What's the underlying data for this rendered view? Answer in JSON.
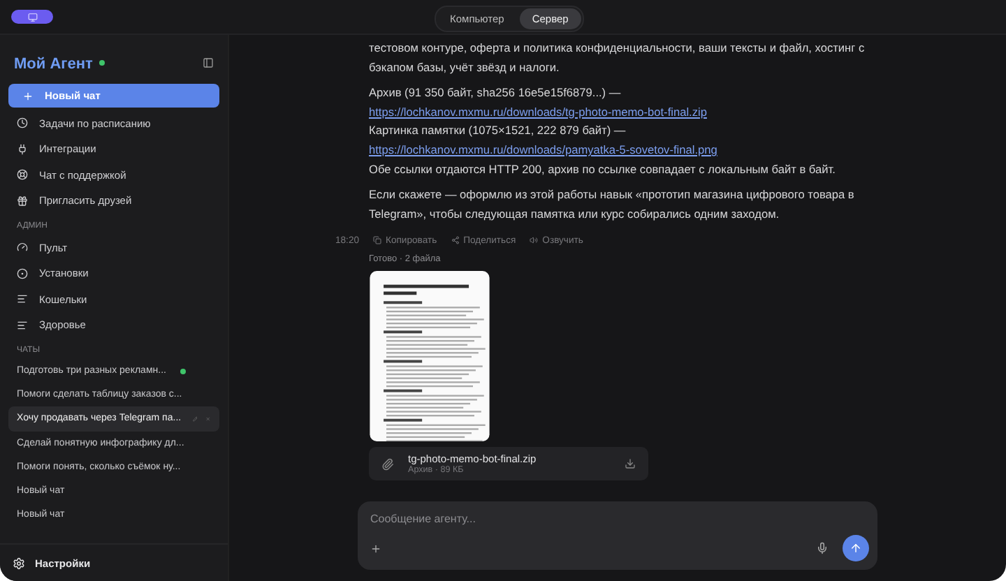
{
  "top_bar": {
    "tabs": [
      {
        "label": "Компьютер",
        "selected": false
      },
      {
        "label": "Сервер",
        "selected": true
      }
    ]
  },
  "sidebar": {
    "title": "Мой Агент",
    "online": true,
    "new_chat": "Новый чат",
    "nav": [
      "Задачи по расписанию",
      "Интеграции",
      "Чат с поддержкой",
      "Пригласить друзей"
    ],
    "admin_heading": "АДМИН",
    "admin": [
      "Пульт",
      "Установки",
      "Кошельки",
      "Здоровье"
    ],
    "chats_heading": "ЧАТЫ",
    "chats": [
      {
        "title": "Подготовь три разных рекламн...",
        "selected": false,
        "running": true
      },
      {
        "title": "Помоги сделать таблицу заказов с...",
        "selected": false,
        "running": false
      },
      {
        "title": "Хочу продавать через Telegram па...",
        "selected": true,
        "running": false
      },
      {
        "title": "Сделай понятную инфографику дл...",
        "selected": false,
        "running": false
      },
      {
        "title": "Помоги понять, сколько съёмок ну...",
        "selected": false,
        "running": false
      },
      {
        "title": "Новый чат",
        "selected": false,
        "running": false
      },
      {
        "title": "Новый чат",
        "selected": false,
        "running": false
      }
    ],
    "settings": "Настройки"
  },
  "message": {
    "paragraphs": [
      [
        {
          "text": "тестовом контуре, оферта и политика конфиденциальности, ваши тексты и файл, хостинг с бэкапом базы, учёт звёзд и налоги."
        }
      ],
      [
        {
          "text": "Архив (91 350 байт, sha256 16e5e15f6879...) —",
          "link": "https://lochkanov.mxmu.ru/downloads/tg-photo-memo-bot-final.zip"
        },
        {
          "text": "Картинка памятки (1075×1521, 222 879 байт) —",
          "link": "https://lochkanov.mxmu.ru/downloads/pamyatka-5-sovetov-final.png"
        },
        {
          "text": "Обе ссылки отдаются HTTP 200, архив по ссылке совпадает с локальным байт в байт."
        }
      ],
      [
        {
          "text": "Если скажете — оформлю из этой работы навык «прототип магазина цифрового товара в Telegram», чтобы следующая памятка или курс собирались одним заходом."
        }
      ]
    ],
    "time": "18:20",
    "actions": [
      "Копировать",
      "Поделиться",
      "Озвучить"
    ],
    "status": "Готово · 2 файла",
    "file": {
      "name": "tg-photo-memo-bot-final.zip",
      "meta": "Архив · 89 КБ"
    }
  },
  "composer": {
    "placeholder": "Сообщение агенту..."
  }
}
